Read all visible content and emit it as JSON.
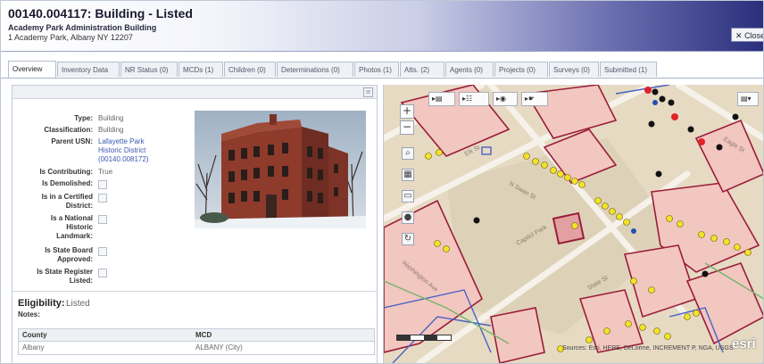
{
  "header": {
    "title": "00140.004117: Building - Listed",
    "subtitle": "Academy Park Administration Building",
    "address": "1 Academy Park, Albany NY 12207",
    "close_label": "Close"
  },
  "tabs": [
    {
      "label": "Overview",
      "active": true
    },
    {
      "label": "Inventory Data"
    },
    {
      "label": "NR Status (0)"
    },
    {
      "label": "MCDs (1)"
    },
    {
      "label": "Children (0)"
    },
    {
      "label": "Determinations (0)"
    },
    {
      "label": "Photos (1)"
    },
    {
      "label": "Atts. (2)"
    },
    {
      "label": "Agents (0)"
    },
    {
      "label": "Projects (0)"
    },
    {
      "label": "Surveys (0)"
    },
    {
      "label": "Submitted (1)"
    }
  ],
  "properties": {
    "type_label": "Type:",
    "type_value": "Building",
    "classification_label": "Classification:",
    "classification_value": "Building",
    "parent_usn_label": "Parent USN:",
    "parent_usn_line1": "Lafayette Park",
    "parent_usn_line2": "Historic District",
    "parent_usn_line3": "(00140.008172)",
    "contributing_label": "Is Contributing:",
    "contributing_value": "True",
    "demolished_label": "Is Demolished:",
    "certified_label_1": "Is in a Certified",
    "certified_label_2": "District:",
    "landmark_label_1": "Is a National",
    "landmark_label_2": "Historic",
    "landmark_label_3": "Landmark:",
    "stateboard_label_1": "Is State Board",
    "stateboard_label_2": "Approved:",
    "stateregister_label_1": "Is State Register",
    "stateregister_label_2": "Listed:"
  },
  "eligibility": {
    "label": "Eligibility:",
    "value": "Listed",
    "notes_label": "Notes:"
  },
  "mcd_table": {
    "headers": [
      "County",
      "MCD"
    ],
    "rows": [
      [
        "Albany",
        "ALBANY (City)"
      ]
    ]
  },
  "map": {
    "attribution": "Sources: Esri, HERE, DeLorme, INCREMENT P, NGA, USGS",
    "logo": "esri",
    "streets": [
      "Elk St",
      "N Swan St",
      "Capitol Park",
      "Eagle St",
      "Washington Ave",
      "State St"
    ]
  },
  "colors": {
    "parcel_fill": "#f4c9c4",
    "parcel_outline": "#9b1c3a",
    "district_outline": "#4a62c6",
    "marker_yellow": "#f2e32a",
    "marker_red": "#e0222a",
    "marker_black": "#111111"
  }
}
